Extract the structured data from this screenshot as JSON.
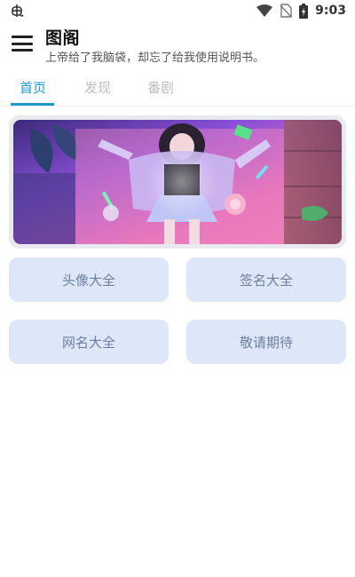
{
  "status_bar": {
    "time": "9:03",
    "left_icon": "bug-icon",
    "icons": [
      "wifi-icon",
      "no-sim-icon",
      "battery-charging-icon"
    ]
  },
  "app_bar": {
    "menu_icon": "hamburger-menu-icon",
    "title": "图阁",
    "subtitle": "上帝给了我脑袋，却忘了给我使用说明书。"
  },
  "tabs": [
    {
      "label": "首页",
      "active": true
    },
    {
      "label": "发现",
      "active": false
    },
    {
      "label": "番剧",
      "active": false
    }
  ],
  "banner": {
    "image": "girl-lying-on-pink-rug-neon-photo"
  },
  "grid_buttons": [
    {
      "label": "头像大全"
    },
    {
      "label": "签名大全"
    },
    {
      "label": "网名大全"
    },
    {
      "label": "敬请期待"
    }
  ],
  "colors": {
    "accent": "#2196c9",
    "button_bg": "#dde7f7",
    "button_text": "#6a7fa0",
    "inactive_tab": "#bdbdbd"
  }
}
